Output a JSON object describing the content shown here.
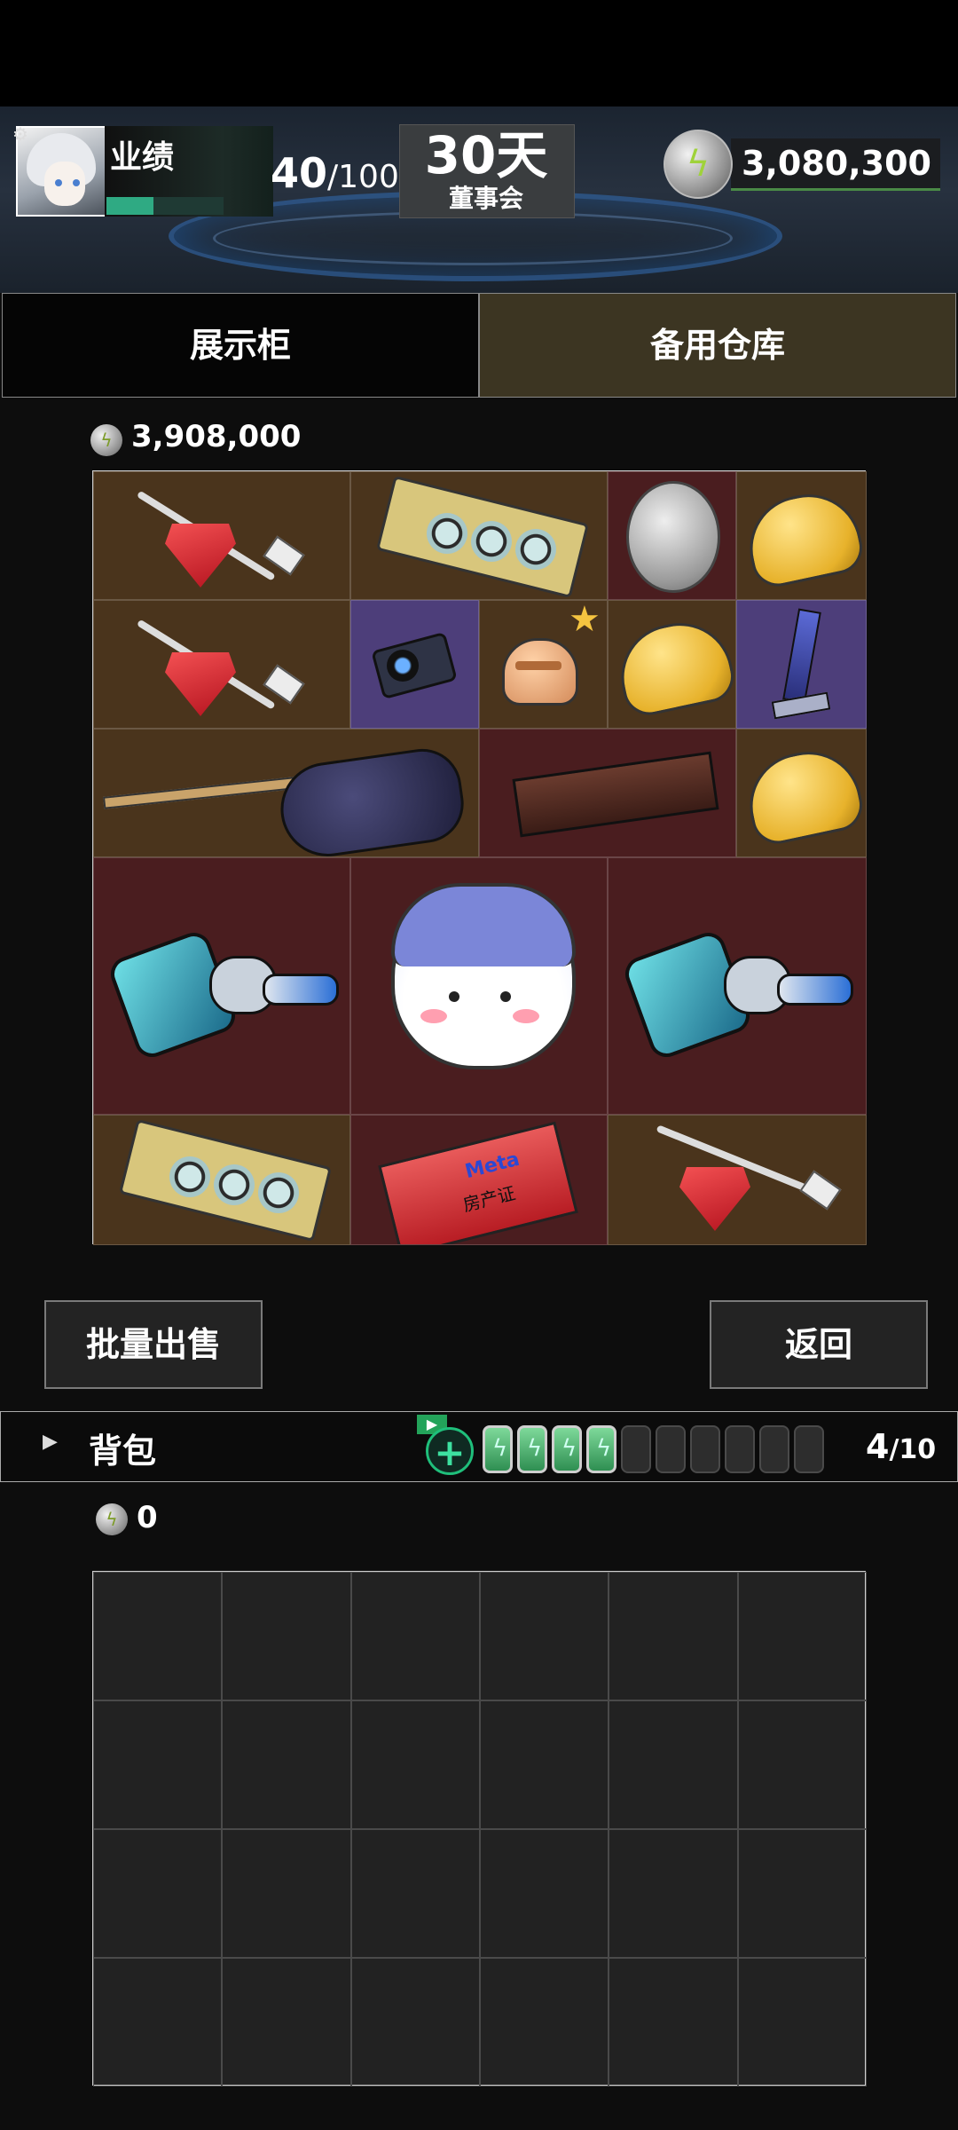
{
  "header": {
    "performance_label": "业绩",
    "performance_current": "40",
    "performance_max": "/100",
    "performance_fraction": 0.4,
    "days_value": "30天",
    "days_label": "董事会",
    "money": "3,080,300"
  },
  "tabs": [
    {
      "label": "展示柜",
      "active": false
    },
    {
      "label": "备用仓库",
      "active": true
    }
  ],
  "storage": {
    "total_value": "3,908,000",
    "items": [
      {
        "name": "红宝石钻头",
        "icon": "red-gem-drill-icon"
      },
      {
        "name": "显卡",
        "icon": "graphics-card-icon"
      },
      {
        "name": "银币",
        "icon": "silver-coin-icon"
      },
      {
        "name": "奶酪",
        "icon": "cheese-icon"
      },
      {
        "name": "相机",
        "icon": "camera-icon"
      },
      {
        "name": "头盔",
        "icon": "helmet-icon"
      },
      {
        "name": "蓝色剑奖杯",
        "icon": "sword-trophy-icon"
      },
      {
        "name": "电吉他",
        "icon": "electric-guitar-icon"
      },
      {
        "name": "木盒",
        "icon": "wooden-box-icon"
      },
      {
        "name": "机器人",
        "icon": "robot-icon"
      },
      {
        "name": "猫咪玩偶",
        "icon": "cat-plush-icon"
      },
      {
        "name": "房产证",
        "icon": "property-deed-icon"
      }
    ],
    "deed_text": "房产证",
    "deed_brand": "Meta"
  },
  "buttons": {
    "bulk_sell": "批量出售",
    "back": "返回"
  },
  "backpack": {
    "title": "背包",
    "ad_icon": "▶",
    "add_icon": "+",
    "slots_used": 4,
    "slots_total": 10,
    "count_current": "4",
    "count_max": "/10",
    "value": "0"
  }
}
